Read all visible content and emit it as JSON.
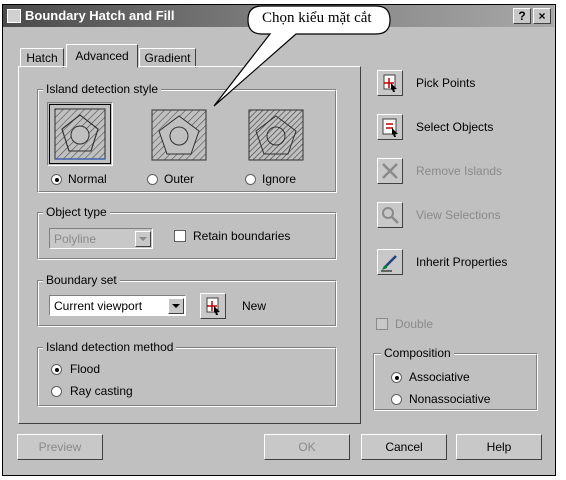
{
  "window": {
    "title": "Boundary Hatch and Fill",
    "help_glyph": "?",
    "close_glyph": "×"
  },
  "callout": {
    "text": "Chọn kiểu mặt cắt"
  },
  "tabs": [
    {
      "label": "Hatch",
      "active": false
    },
    {
      "label": "Advanced",
      "active": true
    },
    {
      "label": "Gradient",
      "active": false
    }
  ],
  "island_detection_style": {
    "legend": "Island detection style",
    "options": [
      {
        "label": "Normal",
        "selected": true
      },
      {
        "label": "Outer",
        "selected": false
      },
      {
        "label": "Ignore",
        "selected": false
      }
    ]
  },
  "object_type": {
    "legend": "Object type",
    "select_value": "Polyline",
    "retain_boundaries_label": "Retain boundaries",
    "retain_boundaries_checked": false
  },
  "boundary_set": {
    "legend": "Boundary set",
    "select_value": "Current viewport",
    "new_label": "New"
  },
  "island_detection_method": {
    "legend": "Island detection method",
    "options": [
      {
        "label": "Flood",
        "selected": true
      },
      {
        "label": "Ray casting",
        "selected": false
      }
    ]
  },
  "actions": [
    {
      "label": "Pick Points",
      "icon": "pick-points-icon",
      "enabled": true
    },
    {
      "label": "Select Objects",
      "icon": "select-objects-icon",
      "enabled": true
    },
    {
      "label": "Remove Islands",
      "icon": "remove-islands-icon",
      "enabled": false
    },
    {
      "label": "View Selections",
      "icon": "view-selections-icon",
      "enabled": false
    },
    {
      "label": "Inherit Properties",
      "icon": "inherit-properties-icon",
      "enabled": true
    }
  ],
  "double": {
    "label": "Double",
    "checked": false,
    "enabled": false
  },
  "composition": {
    "legend": "Composition",
    "options": [
      {
        "label": "Associative",
        "selected": true
      },
      {
        "label": "Nonassociative",
        "selected": false
      }
    ]
  },
  "footer": {
    "preview_label": "Preview",
    "ok_label": "OK",
    "cancel_label": "Cancel",
    "help_label": "Help"
  },
  "colors": {
    "dialog_face": "#c0c0c0",
    "disabled_text": "#8a8a8a",
    "title_gradient_start": "#4a4a4a"
  }
}
